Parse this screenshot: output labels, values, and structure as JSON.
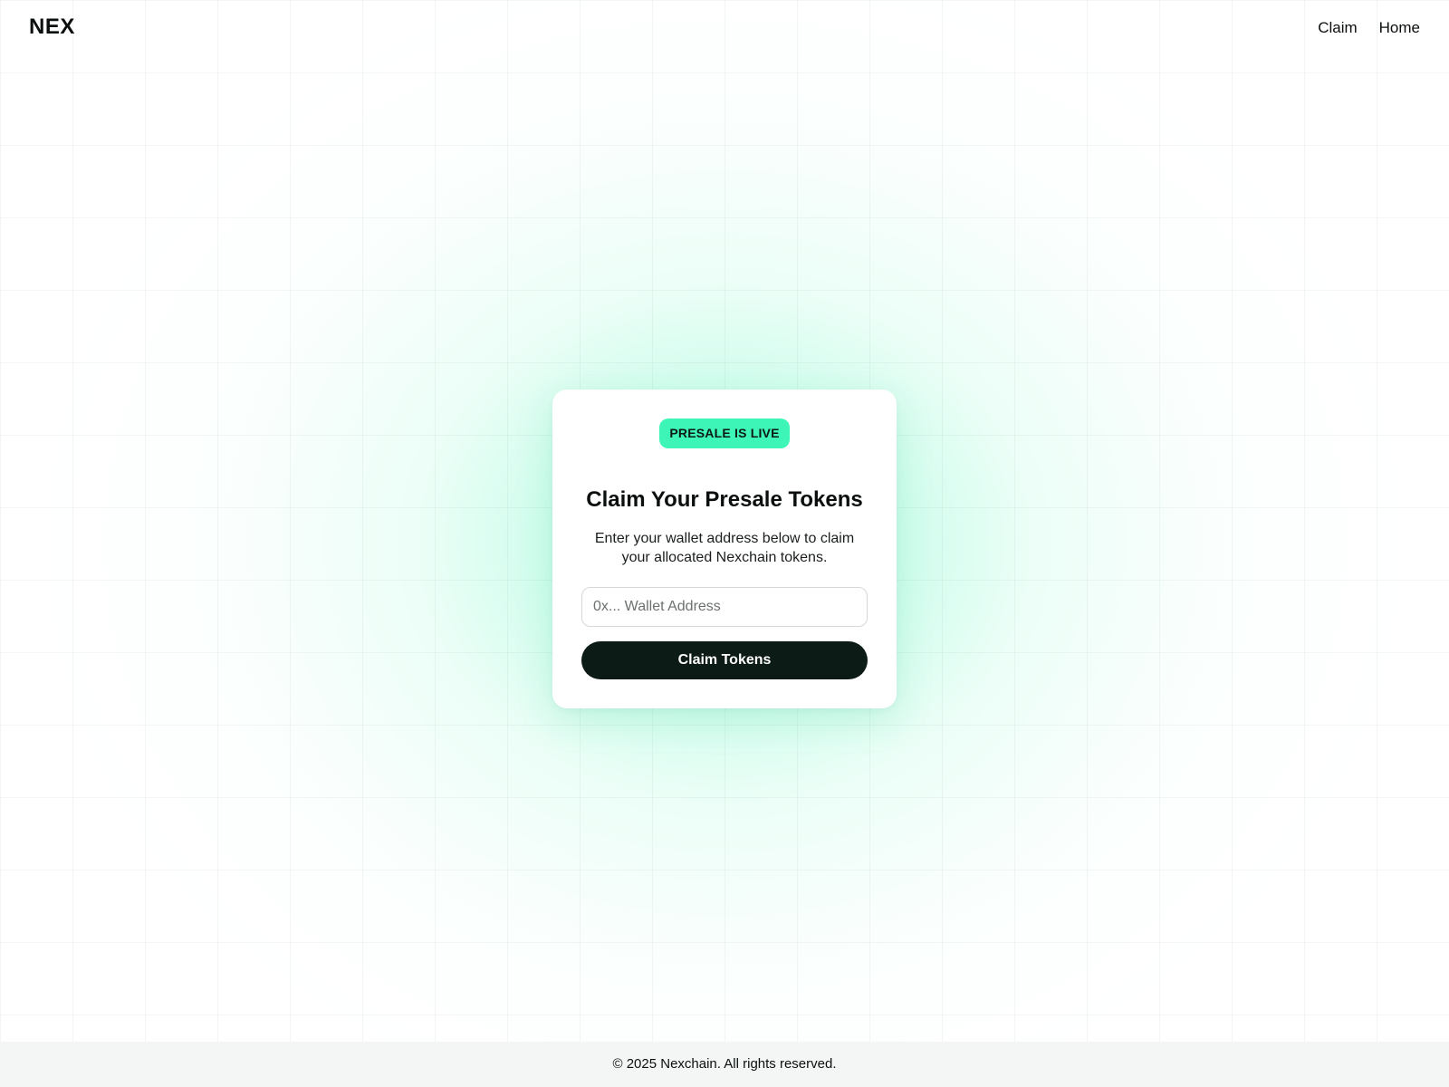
{
  "header": {
    "logo": "NEX",
    "nav": [
      {
        "label": "Claim"
      },
      {
        "label": "Home"
      }
    ]
  },
  "card": {
    "badge": "PRESALE IS LIVE",
    "title": "Claim Your Presale Tokens",
    "description": "Enter your wallet address below to claim your allocated Nexchain tokens.",
    "wallet_input": {
      "value": "",
      "placeholder": "0x... Wallet Address"
    },
    "claim_button": "Claim Tokens"
  },
  "footer": {
    "text": "© 2025 Nexchain. All rights reserved."
  },
  "colors": {
    "accent": "#3df5b6",
    "button_bg": "#0c1b15",
    "footer_bg": "#f3f6f5"
  }
}
